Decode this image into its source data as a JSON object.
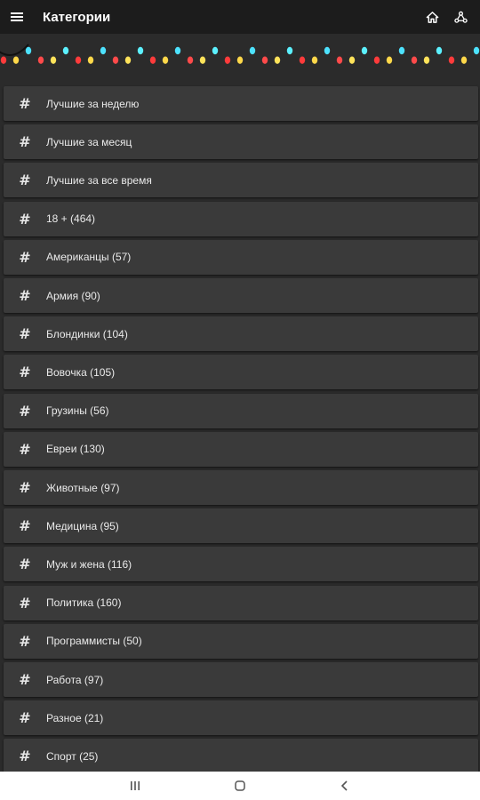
{
  "appbar": {
    "title": "Категории",
    "menu_icon": "hamburger-menu-icon",
    "actions": [
      {
        "icon": "home-icon"
      },
      {
        "icon": "share-network-icon"
      }
    ]
  },
  "garland": {
    "bulb_colors": [
      "#ff3b3b",
      "#ffd84a",
      "#4de2ff",
      "#ff4a4a",
      "#ffe35a",
      "#5cf0ff"
    ],
    "wire_color": "#111111"
  },
  "categories": [
    {
      "icon": "hashtag-icon",
      "label": "Лучшие за неделю"
    },
    {
      "icon": "hashtag-icon",
      "label": "Лучшие за месяц"
    },
    {
      "icon": "hashtag-icon",
      "label": "Лучшие за все время"
    },
    {
      "icon": "hashtag-icon",
      "label": "18 + (464)"
    },
    {
      "icon": "hashtag-icon",
      "label": "Американцы (57)"
    },
    {
      "icon": "hashtag-icon",
      "label": "Армия (90)"
    },
    {
      "icon": "hashtag-icon",
      "label": "Блондинки (104)"
    },
    {
      "icon": "hashtag-icon",
      "label": "Вовочка (105)"
    },
    {
      "icon": "hashtag-icon",
      "label": "Грузины (56)"
    },
    {
      "icon": "hashtag-icon",
      "label": "Евреи (130)"
    },
    {
      "icon": "hashtag-icon",
      "label": "Животные (97)"
    },
    {
      "icon": "hashtag-icon",
      "label": "Медицина (95)"
    },
    {
      "icon": "hashtag-icon",
      "label": "Муж и жена (116)"
    },
    {
      "icon": "hashtag-icon",
      "label": "Политика (160)"
    },
    {
      "icon": "hashtag-icon",
      "label": "Программисты (50)"
    },
    {
      "icon": "hashtag-icon",
      "label": "Работа (97)"
    },
    {
      "icon": "hashtag-icon",
      "label": "Разное (21)"
    },
    {
      "icon": "hashtag-icon",
      "label": "Спорт (25)"
    }
  ],
  "system_nav": [
    {
      "icon": "recent-apps-icon"
    },
    {
      "icon": "home-circle-icon"
    },
    {
      "icon": "back-chevron-icon"
    }
  ],
  "colors": {
    "background": "#2b2b2b",
    "appbar": "#1c1c1c",
    "row": "#3a3a3a",
    "navbar": "#ffffff"
  }
}
